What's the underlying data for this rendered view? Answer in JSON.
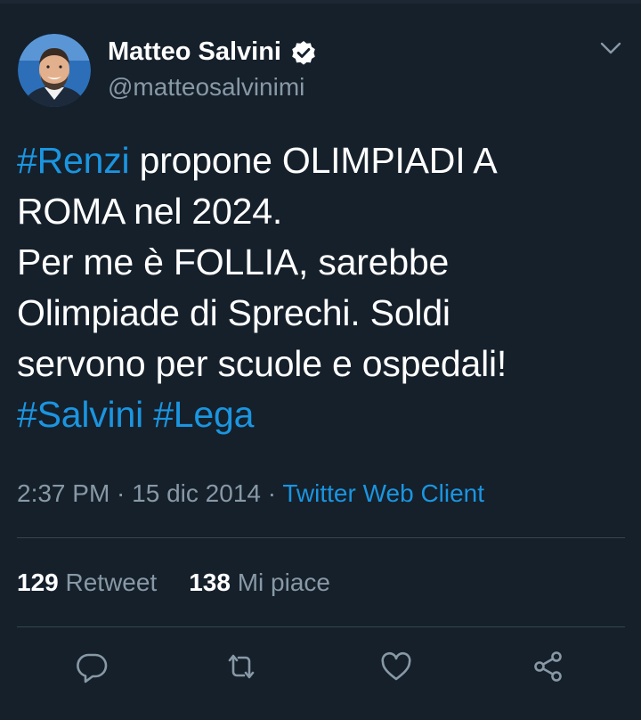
{
  "author": {
    "name": "Matteo Salvini",
    "handle": "@matteosalvinimi",
    "verified": true,
    "avatar_icon": "profile-photo"
  },
  "tweet": {
    "lines": [
      [
        {
          "text": "#Renzi",
          "hashtag": true
        },
        {
          "text": " propone OLIMPIADI A",
          "hashtag": false
        }
      ],
      [
        {
          "text": "ROMA nel 2024.",
          "hashtag": false
        }
      ],
      [
        {
          "text": "Per me è FOLLIA, sarebbe",
          "hashtag": false
        }
      ],
      [
        {
          "text": "Olimpiade di Sprechi. Soldi",
          "hashtag": false
        }
      ],
      [
        {
          "text": "servono per scuole e ospedali!",
          "hashtag": false
        }
      ],
      [
        {
          "text": "#Salvini",
          "hashtag": true
        },
        {
          "text": " ",
          "hashtag": false
        },
        {
          "text": "#Lega",
          "hashtag": true
        }
      ]
    ]
  },
  "meta": {
    "time": "2:37 PM",
    "separator": " · ",
    "date": "15 dic 2014",
    "source": "Twitter Web Client"
  },
  "stats": {
    "retweets_count": "129",
    "retweets_label": "Retweet",
    "likes_count": "138",
    "likes_label": "Mi piace"
  },
  "actions": {
    "reply_icon": "reply-icon",
    "retweet_icon": "retweet-icon",
    "like_icon": "heart-icon",
    "share_icon": "share-icon"
  },
  "colors": {
    "background": "#15202b",
    "text": "#ffffff",
    "secondary": "#8899a6",
    "link": "#1b95e0",
    "divider": "#38444d"
  }
}
